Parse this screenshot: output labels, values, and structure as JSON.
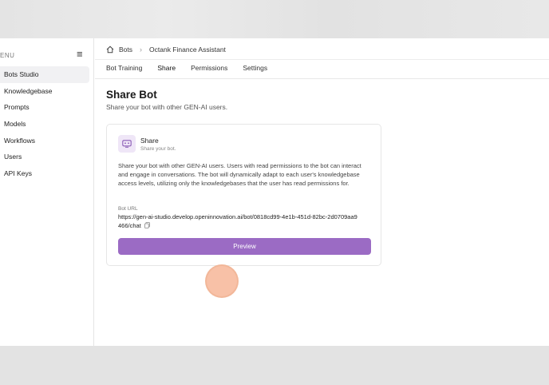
{
  "sidebar": {
    "menu_label": "ENU",
    "items": [
      {
        "label": "Bots Studio",
        "active": true
      },
      {
        "label": "Knowledgebase"
      },
      {
        "label": "Prompts"
      },
      {
        "label": "Models"
      },
      {
        "label": "Workflows"
      },
      {
        "label": "Users"
      },
      {
        "label": "API Keys"
      }
    ]
  },
  "breadcrumb": {
    "root": "Bots",
    "current": "Octank Finance Assistant"
  },
  "tabs": [
    {
      "label": "Bot Training"
    },
    {
      "label": "Share",
      "active": true
    },
    {
      "label": "Permissions"
    },
    {
      "label": "Settings"
    }
  ],
  "page": {
    "title": "Share Bot",
    "subtitle": "Share your bot with other GEN-AI users."
  },
  "card": {
    "title": "Share",
    "subtitle": "Share your bot.",
    "description": "Share your bot with other GEN-AI users. Users with read permissions to the bot can interact and engage in conversations. The bot will dynamically adapt to each user's knowledgebase access levels, utilizing only the knowledgebases that the user has read permissions for.",
    "url_label": "Bot URL",
    "url_value": "https://gen-ai-studio.develop.openinnovation.ai/bot/0818cd99-4e1b-451d-82bc-2d0709aa9466/chat",
    "preview_label": "Preview"
  },
  "colors": {
    "accent": "#9b6bc4",
    "icon_bg": "#efe6f7",
    "click_indicator": "#f5a078"
  }
}
